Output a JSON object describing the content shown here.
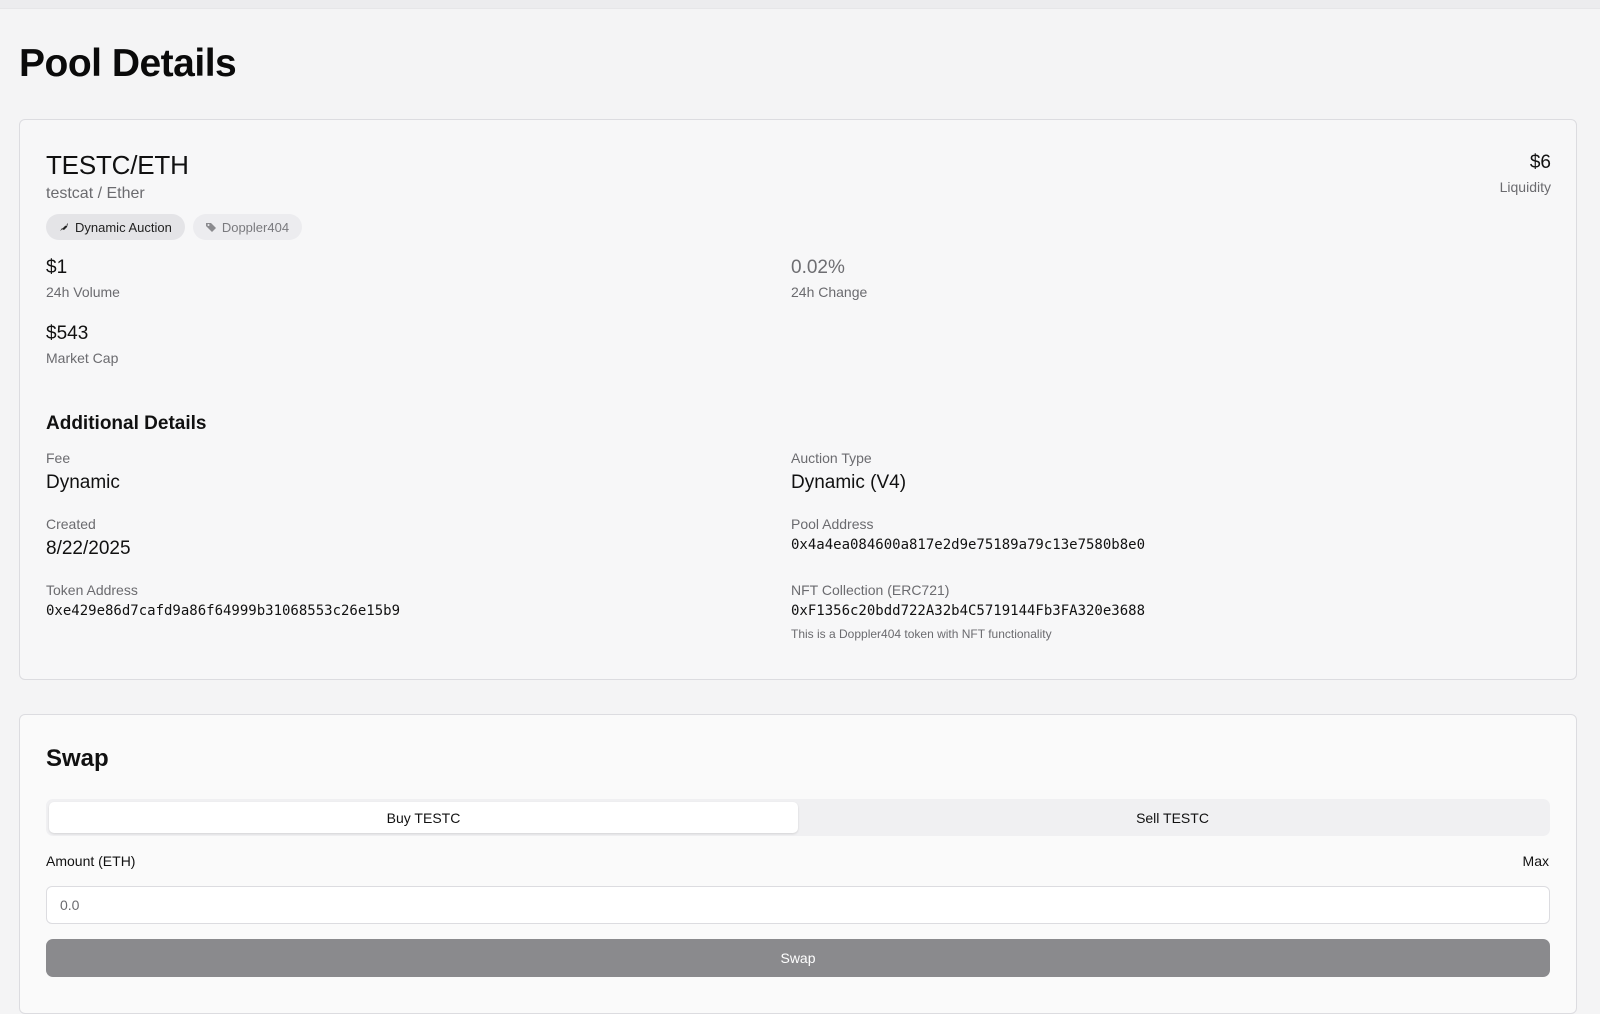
{
  "page": {
    "title": "Pool Details"
  },
  "pool": {
    "pair": "TESTC/ETH",
    "names": "testcat / Ether",
    "badges": [
      {
        "icon": "rocket-icon",
        "label": "Dynamic Auction"
      },
      {
        "icon": "tag-icon",
        "label": "Doppler404"
      }
    ],
    "liquidity": {
      "value": "$6",
      "label": "Liquidity"
    },
    "stats": {
      "volume": {
        "value": "$1",
        "label": "24h Volume"
      },
      "change": {
        "value": "0.02%",
        "label": "24h Change"
      },
      "market_cap": {
        "value": "$543",
        "label": "Market Cap"
      }
    }
  },
  "details": {
    "title": "Additional Details",
    "fee": {
      "label": "Fee",
      "value": "Dynamic"
    },
    "auction_type": {
      "label": "Auction Type",
      "value": "Dynamic (V4)"
    },
    "created": {
      "label": "Created",
      "value": "8/22/2025"
    },
    "pool_address": {
      "label": "Pool Address",
      "value": "0x4a4ea084600a817e2d9e75189a79c13e7580b8e0"
    },
    "token_address": {
      "label": "Token Address",
      "value": "0xe429e86d7cafd9a86f64999b31068553c26e15b9"
    },
    "nft_collection": {
      "label": "NFT Collection (ERC721)",
      "value": "0xF1356c20bdd722A32b4C5719144Fb3FA320e3688",
      "note": "This is a Doppler404 token with NFT functionality"
    }
  },
  "swap": {
    "title": "Swap",
    "tabs": {
      "buy": "Buy TESTC",
      "sell": "Sell TESTC"
    },
    "amount_label": "Amount (ETH)",
    "max_label": "Max",
    "amount_placeholder": "0.0",
    "button_label": "Swap"
  },
  "colors": {
    "background": "#f4f4f5",
    "card": "#f7f7f8",
    "swap_button": "#8a8a8d"
  }
}
